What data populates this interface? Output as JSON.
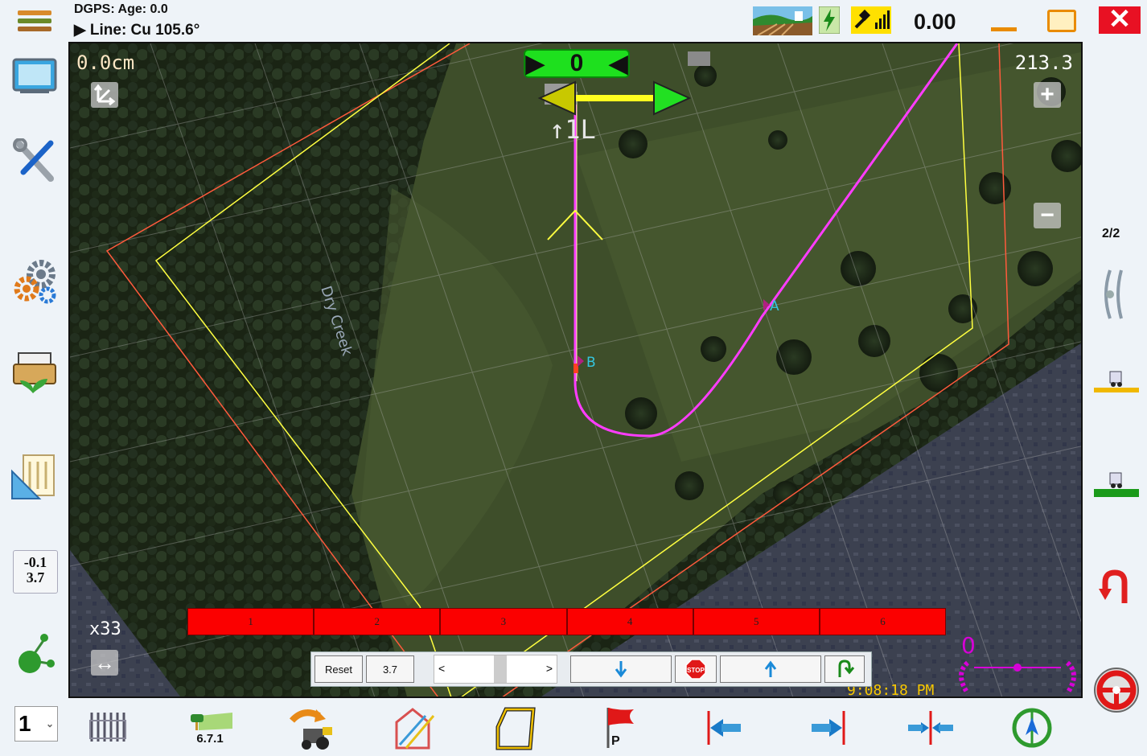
{
  "header": {
    "dgps_label": "DGPS: Age: 0.0",
    "line_label": "▶ Line: Cu 105.6°",
    "speed": "0.00"
  },
  "map": {
    "xte_readout": "0.0cm",
    "heading": "213.3",
    "lane_indicator": "↑1L",
    "guidance_value": "0",
    "zoom_level": "x33",
    "clock": "9:08:18 PM",
    "creek_label": "Dry Creek",
    "point_a": "A",
    "point_b": "B",
    "steer_angle": "0"
  },
  "sections": [
    "1",
    "2",
    "3",
    "4",
    "5",
    "6"
  ],
  "controls": {
    "reset_label": "Reset",
    "value": "3.7"
  },
  "left_bar": {
    "offset_top": "-0.1",
    "offset_bottom": "3.7"
  },
  "right_bar": {
    "page": "2/2"
  },
  "bottom_bar": {
    "tool_number": "1",
    "version": "6.7.1"
  },
  "colors": {
    "section_off": "#fb0000",
    "guidance_green": "#1ee01e",
    "path_magenta": "#ff3cff",
    "boundary_yellow": "#ffff40",
    "boundary_red": "#ff5a3c"
  }
}
